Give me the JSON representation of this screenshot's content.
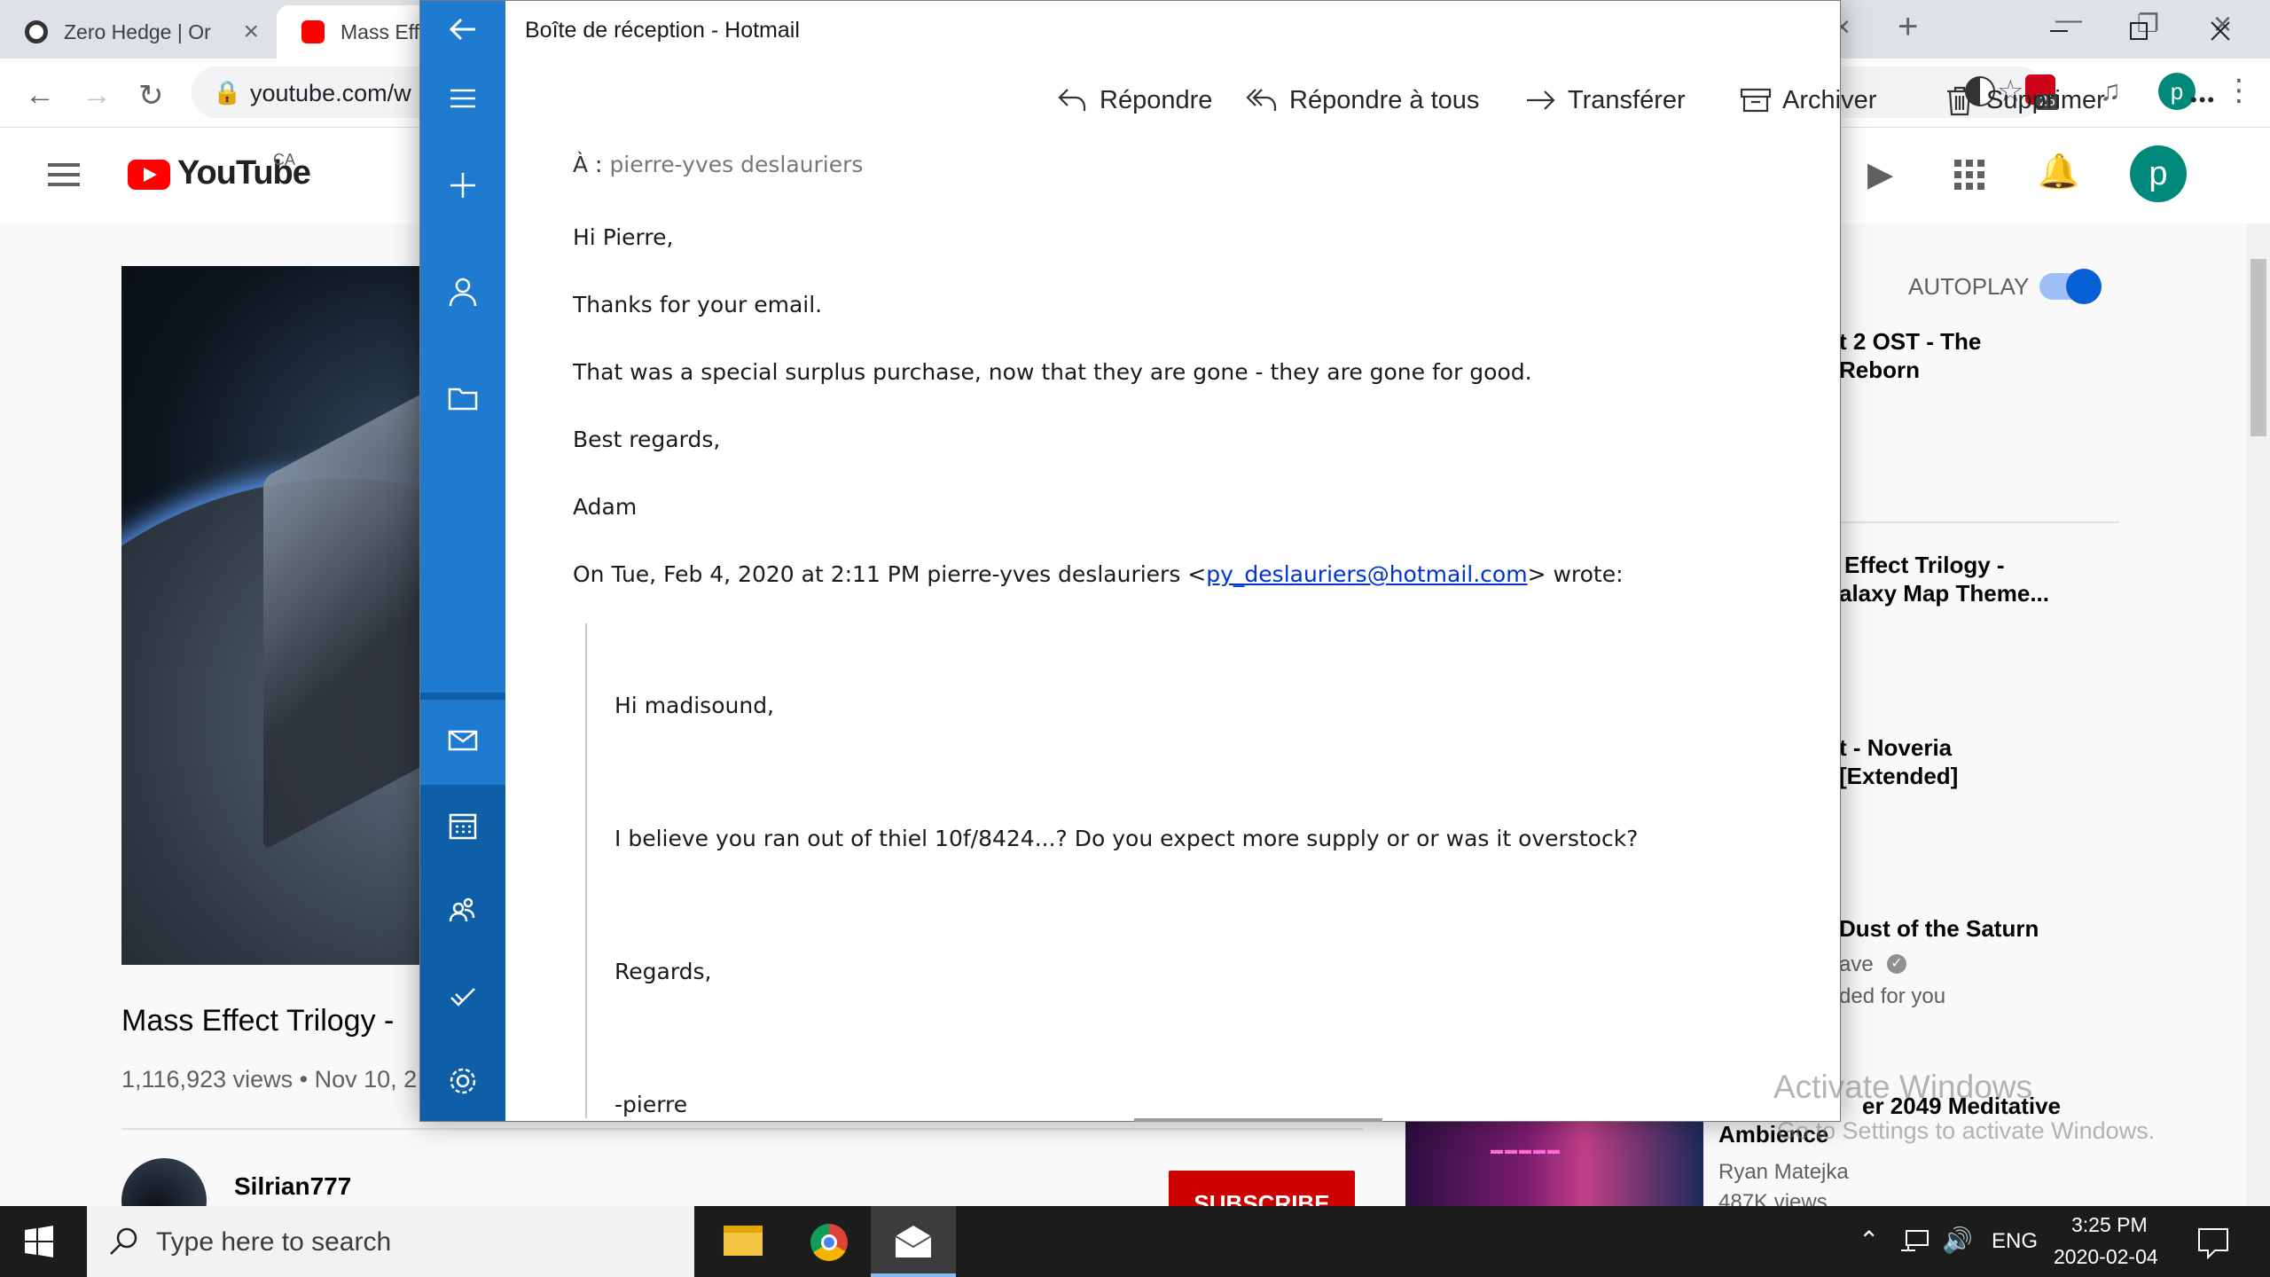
{
  "browser": {
    "tabs": [
      {
        "title": "Zero Hedge | Or"
      },
      {
        "title": "Mass Eff"
      }
    ],
    "url": "youtube.com/w"
  },
  "youtube": {
    "logo_text": "YouTube",
    "region": "CA",
    "video_title": "Mass Effect Trilogy -",
    "views": "1,116,923 views • Nov 10, 2",
    "channel": "Silrian777",
    "subscribe": "SUBSCRIBE",
    "autoplay": "AUTOPLAY",
    "avatar_letter": "p",
    "sidebar": [
      {
        "title_1": "t 2 OST - The",
        "title_2": "Reborn"
      },
      {
        "title_1": "Effect Trilogy -",
        "title_2": "alaxy Map Theme..."
      },
      {
        "title_1": "t - Noveria",
        "title_2": "[Extended]"
      },
      {
        "title_1": "Dust of the Saturn",
        "sub_1": "ave",
        "sub_2": "ded for you"
      },
      {
        "title_1": "er 2049 Meditative",
        "title_2": "Ambience",
        "sub_1": "Ryan Matejka",
        "sub_2": "487K views"
      }
    ]
  },
  "mail": {
    "window_title": "Boîte de réception - Hotmail",
    "toolbar": {
      "reply": "Répondre",
      "reply_all": "Répondre à tous",
      "forward": "Transférer",
      "archive": "Archiver",
      "delete": "Supprimer",
      "more": "•••"
    },
    "to_label": "À :",
    "to_value": "pierre-yves deslauriers",
    "body": {
      "greeting": "Hi Pierre,",
      "p1": "Thanks for your email.",
      "p2": "That was a special surplus purchase, now that they are gone - they are gone for good.",
      "closing": "Best regards,",
      "signature": "Adam",
      "quote_header_pre": "On Tue, Feb 4, 2020 at 2:11 PM pierre-yves deslauriers <",
      "quote_email": "py_deslauriers@hotmail.com",
      "quote_header_post": "> wrote:"
    },
    "quote": {
      "greeting": "Hi madisound,",
      "p1": "I believe you ran out of thiel 10f/8424...? Do you expect more supply or or was it overstock?",
      "closing": "Regards,",
      "signature": "-pierre"
    }
  },
  "watermark": {
    "line1": "Activate Windows",
    "line2": "Go to Settings to activate Windows."
  },
  "taskbar": {
    "search_placeholder": "Type here to search",
    "language": "ENG",
    "time": "3:25 PM",
    "date": "2020-02-04",
    "abp_badge": "25"
  }
}
